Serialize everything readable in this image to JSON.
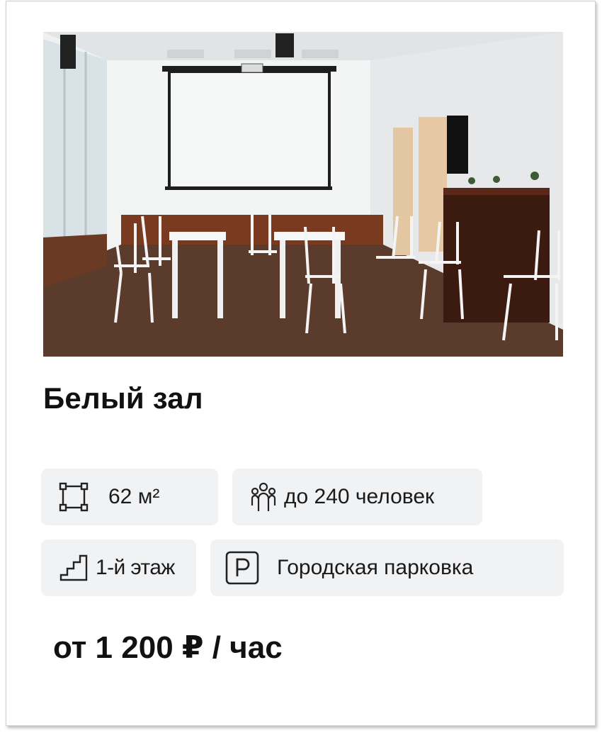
{
  "venue": {
    "title": "Белый зал",
    "photo_icon": "hall-photo",
    "features": {
      "area": {
        "icon": "area-square-icon",
        "label": "62 м²"
      },
      "capacity": {
        "icon": "people-group-icon",
        "label": "до 240 человек"
      },
      "floor": {
        "icon": "stairs-icon",
        "label": "1-й этаж"
      },
      "parking": {
        "icon": "parking-icon",
        "label": "Городская парковка"
      }
    },
    "price": "от 1 200 ₽ / час"
  },
  "colors": {
    "chip_background": "#f1f2f4",
    "text": "#111111"
  }
}
